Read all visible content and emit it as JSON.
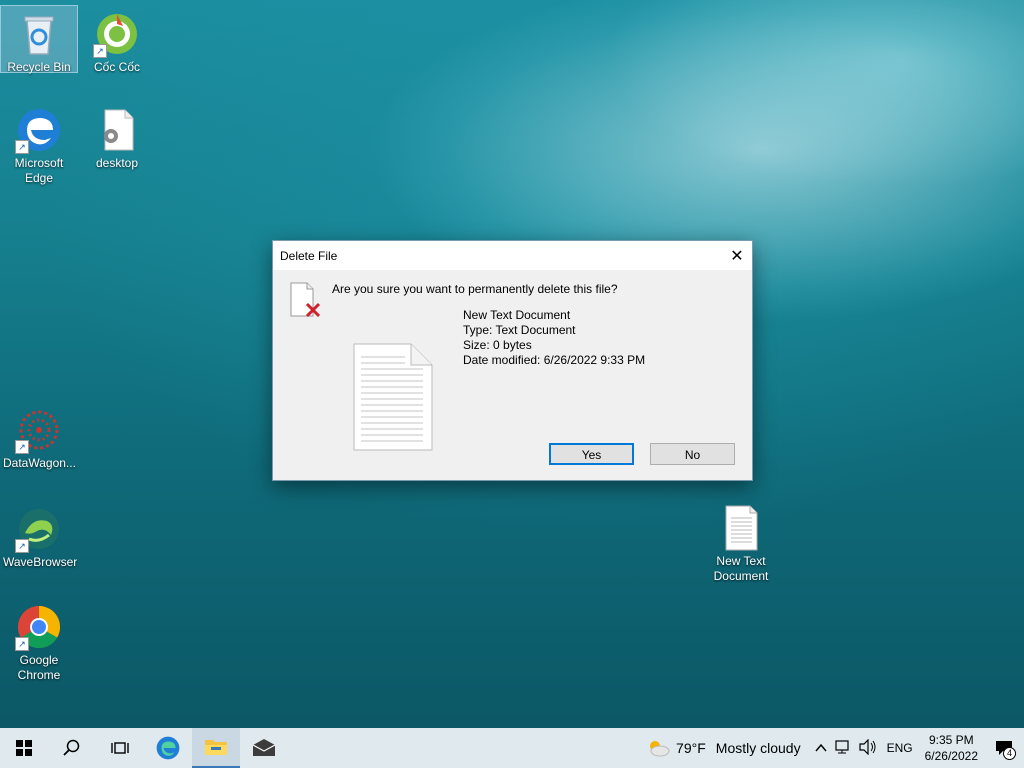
{
  "desktop": {
    "icons": [
      {
        "label": "Recycle Bin"
      },
      {
        "label": "Cốc Cốc"
      },
      {
        "label": "Microsoft Edge"
      },
      {
        "label": "desktop"
      },
      {
        "label": "DataWagon..."
      },
      {
        "label": "WaveBrowser"
      },
      {
        "label": "Google Chrome"
      },
      {
        "label": "New Text Document"
      }
    ]
  },
  "dialog": {
    "title": "Delete File",
    "close_glyph": "✕",
    "question": "Are you sure you want to permanently delete this file?",
    "file_name": "New Text Document",
    "file_type": "Type: Text Document",
    "file_size": "Size: 0 bytes",
    "file_date": "Date modified: 6/26/2022 9:33 PM",
    "yes_label": "Yes",
    "no_label": "No"
  },
  "taskbar": {
    "weather_temp": "79°F",
    "weather_desc": "Mostly cloudy",
    "language": "ENG",
    "time": "9:35 PM",
    "date": "6/26/2022",
    "notification_count": "4"
  }
}
